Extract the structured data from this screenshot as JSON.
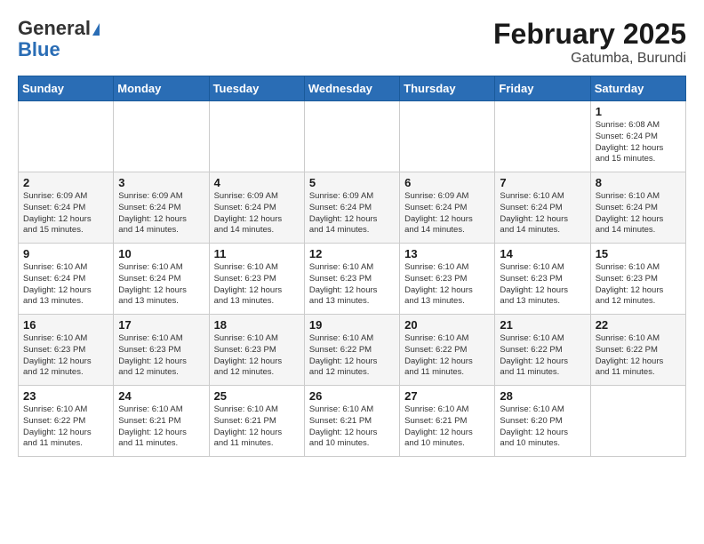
{
  "header": {
    "logo_general": "General",
    "logo_blue": "Blue",
    "month_title": "February 2025",
    "location": "Gatumba, Burundi"
  },
  "weekdays": [
    "Sunday",
    "Monday",
    "Tuesday",
    "Wednesday",
    "Thursday",
    "Friday",
    "Saturday"
  ],
  "weeks": [
    [
      {
        "day": "",
        "info": ""
      },
      {
        "day": "",
        "info": ""
      },
      {
        "day": "",
        "info": ""
      },
      {
        "day": "",
        "info": ""
      },
      {
        "day": "",
        "info": ""
      },
      {
        "day": "",
        "info": ""
      },
      {
        "day": "1",
        "info": "Sunrise: 6:08 AM\nSunset: 6:24 PM\nDaylight: 12 hours\nand 15 minutes."
      }
    ],
    [
      {
        "day": "2",
        "info": "Sunrise: 6:09 AM\nSunset: 6:24 PM\nDaylight: 12 hours\nand 15 minutes."
      },
      {
        "day": "3",
        "info": "Sunrise: 6:09 AM\nSunset: 6:24 PM\nDaylight: 12 hours\nand 14 minutes."
      },
      {
        "day": "4",
        "info": "Sunrise: 6:09 AM\nSunset: 6:24 PM\nDaylight: 12 hours\nand 14 minutes."
      },
      {
        "day": "5",
        "info": "Sunrise: 6:09 AM\nSunset: 6:24 PM\nDaylight: 12 hours\nand 14 minutes."
      },
      {
        "day": "6",
        "info": "Sunrise: 6:09 AM\nSunset: 6:24 PM\nDaylight: 12 hours\nand 14 minutes."
      },
      {
        "day": "7",
        "info": "Sunrise: 6:10 AM\nSunset: 6:24 PM\nDaylight: 12 hours\nand 14 minutes."
      },
      {
        "day": "8",
        "info": "Sunrise: 6:10 AM\nSunset: 6:24 PM\nDaylight: 12 hours\nand 14 minutes."
      }
    ],
    [
      {
        "day": "9",
        "info": "Sunrise: 6:10 AM\nSunset: 6:24 PM\nDaylight: 12 hours\nand 13 minutes."
      },
      {
        "day": "10",
        "info": "Sunrise: 6:10 AM\nSunset: 6:24 PM\nDaylight: 12 hours\nand 13 minutes."
      },
      {
        "day": "11",
        "info": "Sunrise: 6:10 AM\nSunset: 6:23 PM\nDaylight: 12 hours\nand 13 minutes."
      },
      {
        "day": "12",
        "info": "Sunrise: 6:10 AM\nSunset: 6:23 PM\nDaylight: 12 hours\nand 13 minutes."
      },
      {
        "day": "13",
        "info": "Sunrise: 6:10 AM\nSunset: 6:23 PM\nDaylight: 12 hours\nand 13 minutes."
      },
      {
        "day": "14",
        "info": "Sunrise: 6:10 AM\nSunset: 6:23 PM\nDaylight: 12 hours\nand 13 minutes."
      },
      {
        "day": "15",
        "info": "Sunrise: 6:10 AM\nSunset: 6:23 PM\nDaylight: 12 hours\nand 12 minutes."
      }
    ],
    [
      {
        "day": "16",
        "info": "Sunrise: 6:10 AM\nSunset: 6:23 PM\nDaylight: 12 hours\nand 12 minutes."
      },
      {
        "day": "17",
        "info": "Sunrise: 6:10 AM\nSunset: 6:23 PM\nDaylight: 12 hours\nand 12 minutes."
      },
      {
        "day": "18",
        "info": "Sunrise: 6:10 AM\nSunset: 6:23 PM\nDaylight: 12 hours\nand 12 minutes."
      },
      {
        "day": "19",
        "info": "Sunrise: 6:10 AM\nSunset: 6:22 PM\nDaylight: 12 hours\nand 12 minutes."
      },
      {
        "day": "20",
        "info": "Sunrise: 6:10 AM\nSunset: 6:22 PM\nDaylight: 12 hours\nand 11 minutes."
      },
      {
        "day": "21",
        "info": "Sunrise: 6:10 AM\nSunset: 6:22 PM\nDaylight: 12 hours\nand 11 minutes."
      },
      {
        "day": "22",
        "info": "Sunrise: 6:10 AM\nSunset: 6:22 PM\nDaylight: 12 hours\nand 11 minutes."
      }
    ],
    [
      {
        "day": "23",
        "info": "Sunrise: 6:10 AM\nSunset: 6:22 PM\nDaylight: 12 hours\nand 11 minutes."
      },
      {
        "day": "24",
        "info": "Sunrise: 6:10 AM\nSunset: 6:21 PM\nDaylight: 12 hours\nand 11 minutes."
      },
      {
        "day": "25",
        "info": "Sunrise: 6:10 AM\nSunset: 6:21 PM\nDaylight: 12 hours\nand 11 minutes."
      },
      {
        "day": "26",
        "info": "Sunrise: 6:10 AM\nSunset: 6:21 PM\nDaylight: 12 hours\nand 10 minutes."
      },
      {
        "day": "27",
        "info": "Sunrise: 6:10 AM\nSunset: 6:21 PM\nDaylight: 12 hours\nand 10 minutes."
      },
      {
        "day": "28",
        "info": "Sunrise: 6:10 AM\nSunset: 6:20 PM\nDaylight: 12 hours\nand 10 minutes."
      },
      {
        "day": "",
        "info": ""
      }
    ]
  ]
}
